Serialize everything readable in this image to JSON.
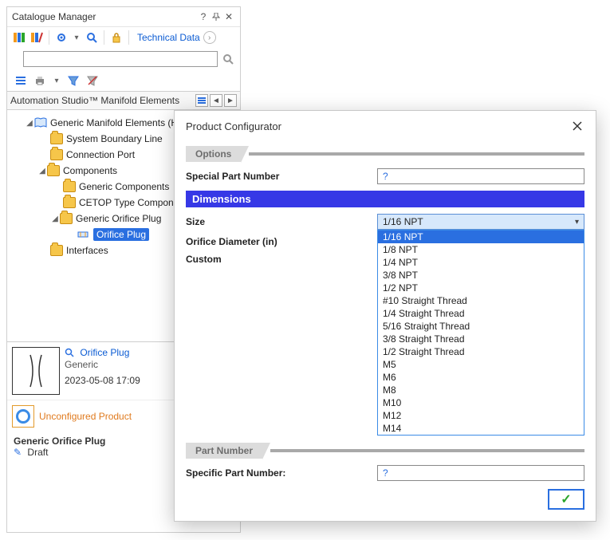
{
  "panel": {
    "title": "Catalogue Manager",
    "tech_link": "Technical Data",
    "lib_label": "Automation Studio™ Manifold Elements",
    "search_placeholder": ""
  },
  "tree": {
    "root": "Generic Manifold Elements (Hydraulic)",
    "n1": "System Boundary Line",
    "n2": "Connection Port",
    "n3": "Components",
    "n3a": "Generic Components",
    "n3b": "CETOP Type Components",
    "n3c": "Generic Orifice Plug",
    "n3c1": "Orifice Plug",
    "n4": "Interfaces"
  },
  "preview": {
    "name": "Orifice Plug",
    "generic": "Generic",
    "date": "2023-05-08 17:09",
    "status": "Unconfigured Product",
    "product_name": "Generic Orifice Plug",
    "state": "Draft"
  },
  "dialog": {
    "title": "Product Configurator",
    "tab_options": "Options",
    "special_part_label": "Special Part Number",
    "special_part_value": "?",
    "dimensions_header": "Dimensions",
    "size_label": "Size",
    "size_value": "1/16 NPT",
    "orifice_label": "Orifice Diameter (in)",
    "custom_label": "Custom",
    "tab_partnum": "Part Number",
    "specific_label": "Specific Part Number:",
    "specific_value": "?",
    "size_options": [
      "1/16 NPT",
      "1/8 NPT",
      "1/4 NPT",
      "3/8 NPT",
      "1/2 NPT",
      "#10 Straight Thread",
      "1/4 Straight Thread",
      "5/16 Straight Thread",
      "3/8 Straight Thread",
      "1/2 Straight Thread",
      "M5",
      "M6",
      "M8",
      "M10",
      "M12",
      "M14"
    ]
  }
}
